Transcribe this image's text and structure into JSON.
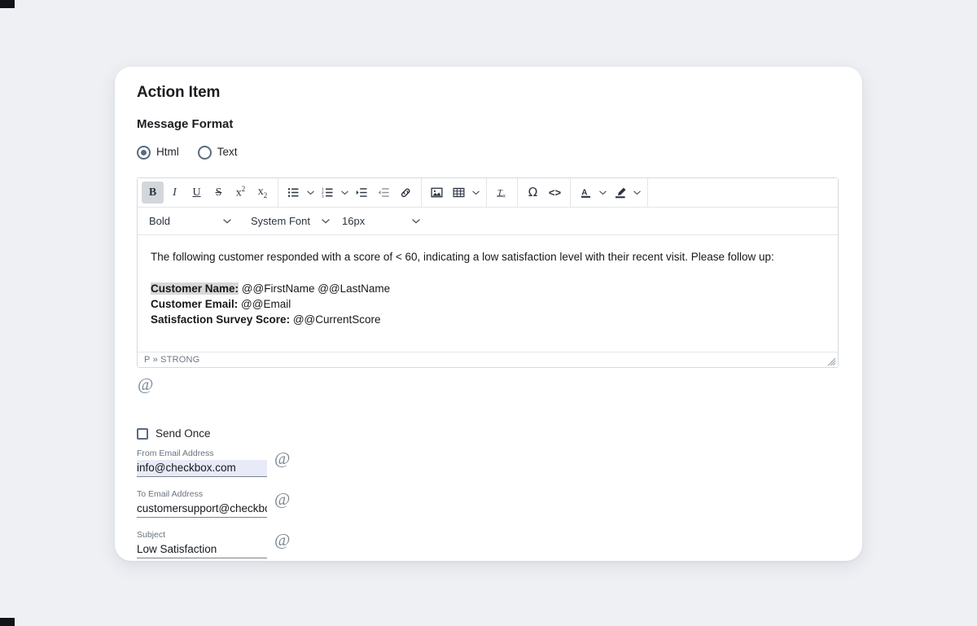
{
  "page": {
    "title": "Action Item",
    "section_label": "Message Format"
  },
  "message_format": {
    "options": [
      {
        "label": "Html",
        "selected": true
      },
      {
        "label": "Text",
        "selected": false
      }
    ]
  },
  "editor": {
    "toolbar": [
      {
        "name": "bold-button",
        "glyph": "B",
        "active": true,
        "caret": false
      },
      {
        "name": "italic-button",
        "glyph": "I",
        "active": false,
        "caret": false
      },
      {
        "name": "underline-button",
        "glyph": "U",
        "active": false,
        "caret": false
      },
      {
        "name": "strikethrough-button",
        "glyph": "S",
        "active": false,
        "caret": false
      },
      {
        "name": "superscript-button",
        "glyph": "x²",
        "active": false,
        "caret": false
      },
      {
        "name": "subscript-button",
        "glyph": "x₂",
        "active": false,
        "caret": false
      },
      {
        "name": "bullet-list-button",
        "glyph": "bullet-list",
        "active": false,
        "caret": true
      },
      {
        "name": "numbered-list-button",
        "glyph": "numbered-list",
        "active": false,
        "caret": true
      },
      {
        "name": "increase-indent-button",
        "glyph": "indent-increase",
        "active": false,
        "caret": false
      },
      {
        "name": "decrease-indent-button",
        "glyph": "indent-decrease",
        "active": false,
        "caret": false
      },
      {
        "name": "insert-link-button",
        "glyph": "link",
        "active": false,
        "caret": false
      },
      {
        "name": "insert-image-button",
        "glyph": "image",
        "active": false,
        "caret": false
      },
      {
        "name": "insert-table-button",
        "glyph": "table",
        "active": false,
        "caret": true
      },
      {
        "name": "clear-formatting-button",
        "glyph": "clear-format",
        "active": false,
        "caret": false
      },
      {
        "name": "special-character-button",
        "glyph": "Ω",
        "active": false,
        "caret": false
      },
      {
        "name": "source-code-button",
        "glyph": "<>",
        "active": false,
        "caret": false
      },
      {
        "name": "text-color-button",
        "glyph": "text-color",
        "active": false,
        "caret": true
      },
      {
        "name": "highlight-color-button",
        "glyph": "highlight",
        "active": false,
        "caret": true
      }
    ],
    "selects": {
      "block_style": "Bold",
      "font_family": "System Font",
      "font_size": "16px"
    },
    "content": {
      "intro": "The following customer responded with a score of < 60, indicating a low satisfaction level with their recent visit. Please follow up:",
      "lines": [
        {
          "label": "Customer Name:",
          "value": "@@FirstName @@LastName",
          "highlighted": true
        },
        {
          "label": "Customer Email:",
          "value": "@@Email",
          "highlighted": false
        },
        {
          "label": "Satisfaction Survey Score:",
          "value": "@@CurrentScore",
          "highlighted": false
        }
      ]
    },
    "status_path": "P » STRONG",
    "merge_icon": "at-icon"
  },
  "settings": {
    "send_once": {
      "label": "Send Once",
      "checked": false
    },
    "fields": [
      {
        "name": "from-email-address",
        "label": "From Email Address",
        "value": "info@checkbox.com",
        "focused": true,
        "merge_icon": "at-icon"
      },
      {
        "name": "to-email-address",
        "label": "To Email Address",
        "value": "customersupport@checkbox.com",
        "focused": false,
        "merge_icon": "at-icon"
      },
      {
        "name": "subject",
        "label": "Subject",
        "value": "Low Satisfaction",
        "focused": false,
        "merge_icon": "at-icon"
      }
    ]
  },
  "colors": {
    "page_background": "#eef0f4",
    "card_background": "#ffffff",
    "accent_slate": "#5b6b80",
    "focus_field": "#e8ebf7",
    "selection_highlight": "#d8d8d8",
    "border": "#d6dade"
  }
}
